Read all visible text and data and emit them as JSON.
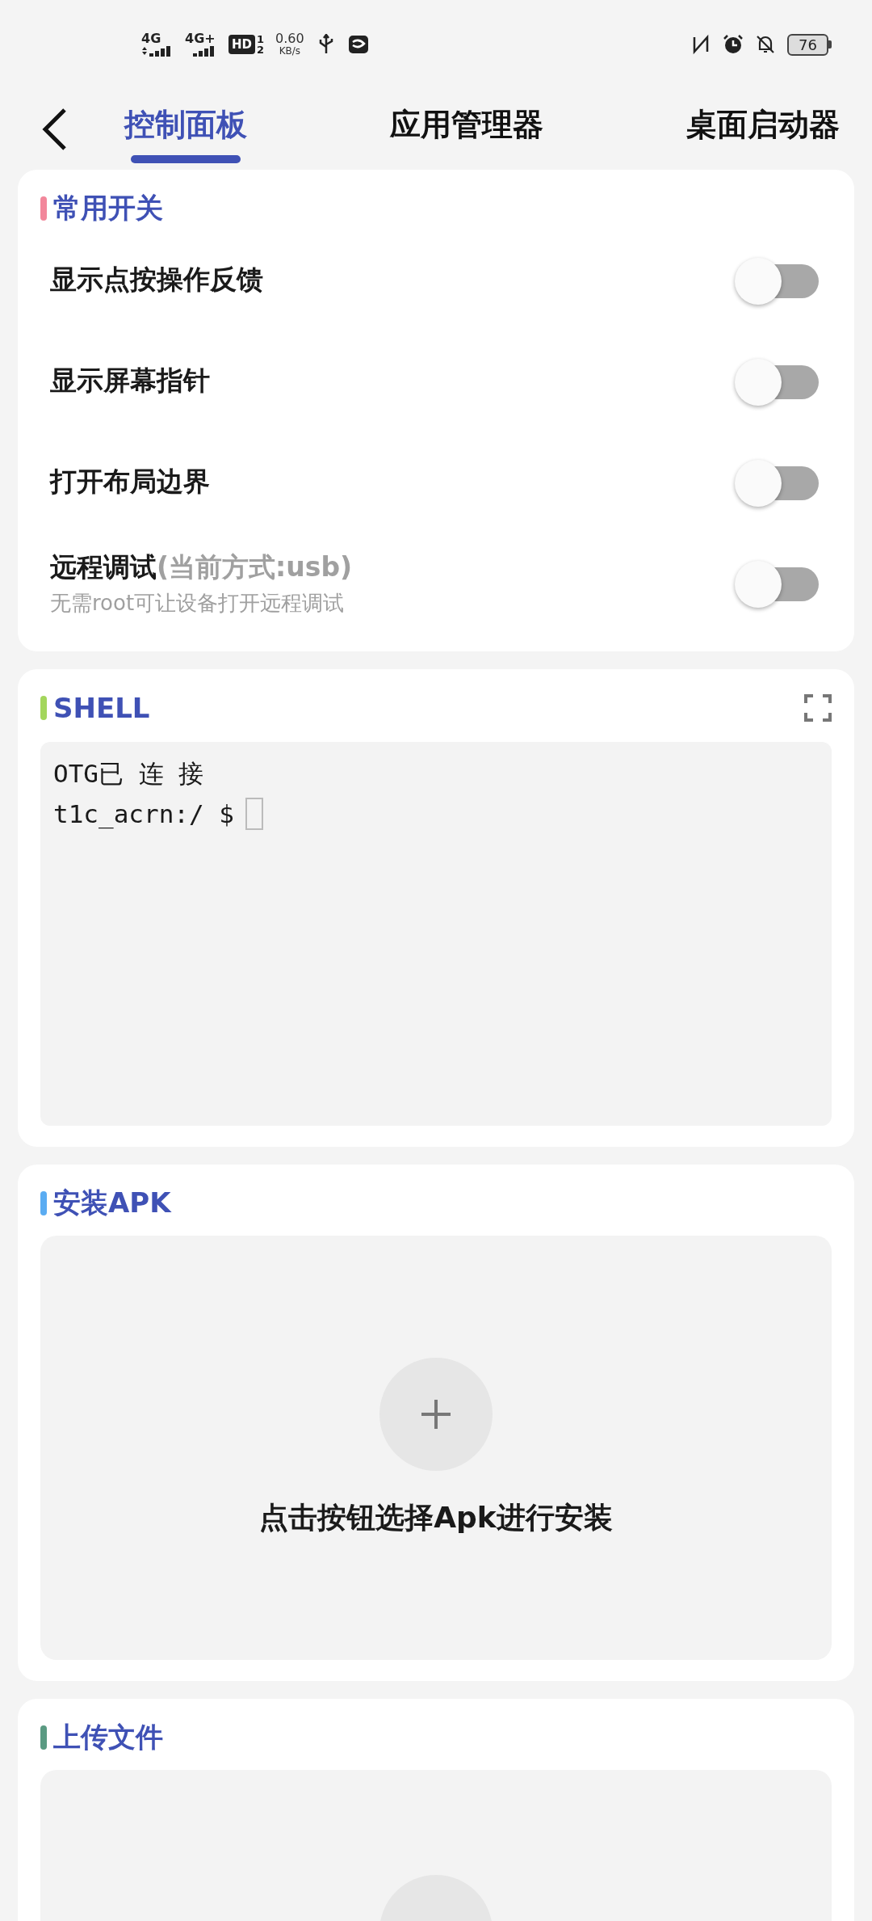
{
  "status_bar": {
    "networks": [
      "4G",
      "4G+"
    ],
    "hd": "HD",
    "hd_sims": [
      "1",
      "2"
    ],
    "speed": "0.60",
    "speed_unit": "KB/s",
    "battery": "76"
  },
  "nav": {
    "tabs": [
      {
        "label": "控制面板",
        "selected": true
      },
      {
        "label": "应用管理器",
        "selected": false
      },
      {
        "label": "桌面启动器",
        "selected": false
      }
    ]
  },
  "sections": [
    {
      "kind": "switches",
      "title": "常用开关",
      "color": "#f2879b",
      "switches": [
        {
          "label": "显示点按操作反馈",
          "on": false
        },
        {
          "label": "显示屏幕指针",
          "on": false
        },
        {
          "label": "打开布局边界",
          "on": false
        },
        {
          "label": "远程调试",
          "note": "(当前方式:usb)",
          "subtitle": "无需root可让设备打开远程调试",
          "on": false
        }
      ]
    },
    {
      "kind": "shell",
      "title": "SHELL",
      "color": "#a3d65c",
      "lines": [
        "OTG已 连 接"
      ],
      "prompt": "t1c_acrn:/ $"
    },
    {
      "kind": "picker",
      "title": "安装APK",
      "color": "#5aacf2",
      "hint": "点击按钮选择Apk进行安装"
    },
    {
      "kind": "picker",
      "title": "上传文件",
      "color": "#5a9a82"
    }
  ]
}
